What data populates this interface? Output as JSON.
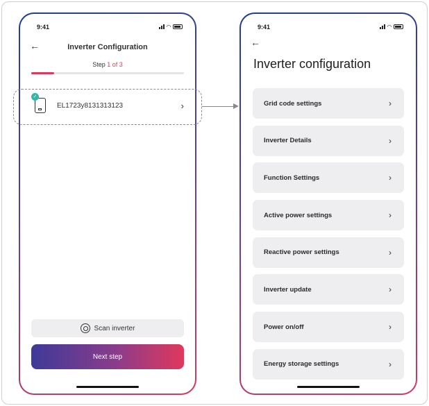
{
  "left_screen": {
    "status_time": "9:41",
    "title": "Inverter Configuration",
    "step": {
      "prefix": "Step ",
      "current": "1 of 3"
    },
    "progress_fraction": 0.15,
    "device": {
      "name": "EL1723y8131313123",
      "icon": "inverter-device-icon",
      "status_icon": "check-icon"
    },
    "scan_button": {
      "label": "Scan inverter",
      "icon": "scan-icon"
    },
    "next_button": {
      "label": "Next step"
    }
  },
  "right_screen": {
    "status_time": "9:41",
    "title": "Inverter configuration",
    "menu_items": [
      {
        "label": "Grid code settings"
      },
      {
        "label": "Inverter Details"
      },
      {
        "label": "Function Settings"
      },
      {
        "label": "Active power settings"
      },
      {
        "label": "Reactive power settings"
      },
      {
        "label": "Inverter update"
      },
      {
        "label": "Power on/off"
      },
      {
        "label": "Energy storage settings"
      }
    ]
  },
  "colors": {
    "accent": "#e0385c",
    "gradient_start": "#3e3a98",
    "check": "#34b5a8",
    "item_bg": "#eeeef0"
  }
}
